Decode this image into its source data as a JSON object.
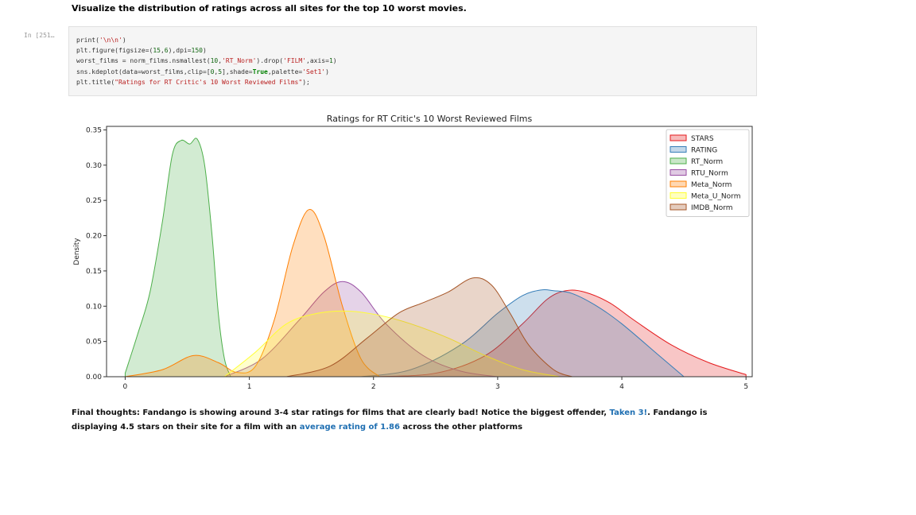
{
  "markdown": {
    "heading": "Visualize the distribution of ratings across all sites for the top 10 worst movies."
  },
  "cell": {
    "prompt": "In [251…",
    "code": [
      [
        {
          "t": "print("
        },
        {
          "t": "'\\n\\n'",
          "c": "str"
        },
        {
          "t": ")"
        }
      ],
      [
        {
          "t": "plt.figure(figsize=("
        },
        {
          "t": "15",
          "c": "num"
        },
        {
          "t": ","
        },
        {
          "t": "6",
          "c": "num"
        },
        {
          "t": "),dpi="
        },
        {
          "t": "150",
          "c": "num"
        },
        {
          "t": ")"
        }
      ],
      [
        {
          "t": "worst_films = norm_films.nsmallest("
        },
        {
          "t": "10",
          "c": "num"
        },
        {
          "t": ","
        },
        {
          "t": "'RT_Norm'",
          "c": "str"
        },
        {
          "t": ").drop("
        },
        {
          "t": "'FILM'",
          "c": "str"
        },
        {
          "t": ",axis="
        },
        {
          "t": "1",
          "c": "num"
        },
        {
          "t": ")"
        }
      ],
      [
        {
          "t": "sns.kdeplot(data=worst_films,clip=["
        },
        {
          "t": "0",
          "c": "num"
        },
        {
          "t": ","
        },
        {
          "t": "5",
          "c": "num"
        },
        {
          "t": "],shade="
        },
        {
          "t": "True",
          "c": "kw"
        },
        {
          "t": ",palette="
        },
        {
          "t": "'Set1'",
          "c": "str"
        },
        {
          "t": ")"
        }
      ],
      [
        {
          "t": "plt.title("
        },
        {
          "t": "\"Ratings for RT Critic's 10 Worst Reviewed Films\"",
          "c": "str"
        },
        {
          "t": ");"
        }
      ]
    ]
  },
  "chart_data": {
    "type": "area",
    "title": "Ratings for RT Critic's 10 Worst Reviewed Films",
    "xlabel": "",
    "ylabel": "Density",
    "xlim": [
      -0.15,
      5.05
    ],
    "ylim": [
      0,
      0.355
    ],
    "xticks": [
      0,
      1,
      2,
      3,
      4,
      5
    ],
    "yticks": [
      0.0,
      0.05,
      0.1,
      0.15,
      0.2,
      0.25,
      0.3,
      0.35
    ],
    "ytick_labels": [
      "0.00",
      "0.05",
      "0.10",
      "0.15",
      "0.20",
      "0.25",
      "0.30",
      "0.35"
    ],
    "grid": false,
    "legend": "top-right",
    "series": [
      {
        "name": "STARS",
        "color": "#e41a1c",
        "x": [
          2.0,
          2.5,
          2.9,
          3.2,
          3.4,
          3.55,
          3.7,
          3.9,
          4.1,
          4.4,
          4.7,
          5.0
        ],
        "y": [
          0.0,
          0.005,
          0.03,
          0.075,
          0.11,
          0.122,
          0.12,
          0.105,
          0.08,
          0.045,
          0.02,
          0.003
        ]
      },
      {
        "name": "RATING",
        "color": "#377eb8",
        "x": [
          1.9,
          2.3,
          2.7,
          3.0,
          3.2,
          3.35,
          3.45,
          3.6,
          3.8,
          4.0,
          4.3,
          4.5
        ],
        "y": [
          0.0,
          0.01,
          0.045,
          0.09,
          0.115,
          0.123,
          0.122,
          0.118,
          0.1,
          0.075,
          0.03,
          0.0
        ]
      },
      {
        "name": "RT_Norm",
        "color": "#4daf4a",
        "x": [
          0.0,
          0.1,
          0.2,
          0.3,
          0.38,
          0.45,
          0.52,
          0.58,
          0.64,
          0.7,
          0.75,
          0.8,
          0.85
        ],
        "y": [
          0.005,
          0.06,
          0.12,
          0.22,
          0.315,
          0.335,
          0.33,
          0.337,
          0.3,
          0.2,
          0.09,
          0.025,
          0.0
        ]
      },
      {
        "name": "RTU_Norm",
        "color": "#984ea3",
        "x": [
          0.8,
          1.1,
          1.4,
          1.6,
          1.75,
          1.9,
          2.1,
          2.4,
          2.7,
          3.0
        ],
        "y": [
          0.0,
          0.025,
          0.08,
          0.12,
          0.135,
          0.12,
          0.075,
          0.03,
          0.008,
          0.0
        ]
      },
      {
        "name": "Meta_Norm",
        "color": "#ff7f00",
        "x": [
          0.0,
          0.3,
          0.55,
          0.75,
          0.9,
          1.05,
          1.2,
          1.35,
          1.48,
          1.6,
          1.75,
          1.9,
          2.05
        ],
        "y": [
          0.0,
          0.01,
          0.03,
          0.02,
          0.006,
          0.015,
          0.08,
          0.185,
          0.237,
          0.2,
          0.1,
          0.025,
          0.0
        ]
      },
      {
        "name": "Meta_U_Norm",
        "color": "#ffff33",
        "x": [
          0.8,
          1.05,
          1.3,
          1.55,
          1.8,
          2.05,
          2.3,
          2.6,
          2.9,
          3.2,
          3.5
        ],
        "y": [
          0.0,
          0.035,
          0.075,
          0.09,
          0.093,
          0.087,
          0.075,
          0.055,
          0.03,
          0.01,
          0.0
        ]
      },
      {
        "name": "IMDB_Norm",
        "color": "#a65628",
        "x": [
          1.3,
          1.65,
          1.95,
          2.2,
          2.4,
          2.6,
          2.8,
          2.95,
          3.1,
          3.25,
          3.45,
          3.6
        ],
        "y": [
          0.0,
          0.015,
          0.055,
          0.09,
          0.105,
          0.12,
          0.14,
          0.13,
          0.09,
          0.045,
          0.01,
          0.0
        ]
      }
    ]
  },
  "final_thoughts": {
    "prefix": "Final thoughts: Fandango is showing around 3-4 star ratings for films that are clearly bad! Notice the biggest offender, ",
    "link1": "Taken 3!",
    "middle": ". Fandango is displaying 4.5 stars on their site for a film with an ",
    "link2": "average rating of 1.86",
    "suffix": " across the other platforms"
  }
}
